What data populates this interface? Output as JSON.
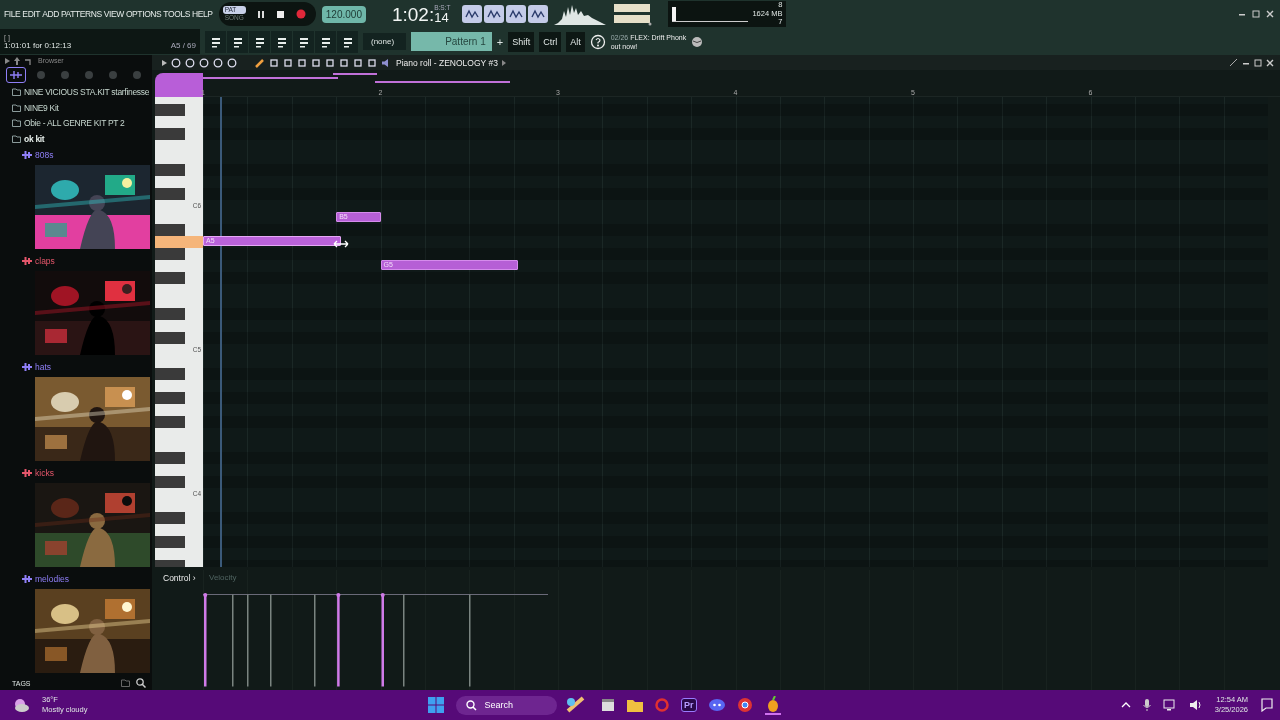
{
  "menu": [
    "FILE",
    "EDIT",
    "ADD",
    "PATTERNS",
    "VIEW",
    "OPTIONS",
    "TOOLS",
    "HELP"
  ],
  "transport": {
    "modes": [
      {
        "label": "PAT",
        "selected": true
      },
      {
        "label": "SONG",
        "selected": false
      }
    ],
    "tempo": "120.000",
    "time": "1:02:",
    "time_ticks": "14",
    "time_format": "B:S:T"
  },
  "hint": {
    "brackets": "[ ]",
    "position": "1:01:01 for 0:12:13",
    "note": "A5 / 69"
  },
  "channel": "(none)",
  "pattern": {
    "name": "Pattern 1",
    "add": "+"
  },
  "modifier_keys": [
    "Shift",
    "Ctrl",
    "Alt"
  ],
  "monitor": {
    "level": 0.04,
    "cpu": "8",
    "memory": "1624 MB",
    "polyphony": "7"
  },
  "news": {
    "date": "02/26",
    "text": "FLEX: Drift Phonk",
    "text_2": "out now!"
  },
  "browser": {
    "title": "Browser",
    "tabs": [
      {
        "selected": true
      },
      {
        "selected": false
      },
      {
        "selected": false
      },
      {
        "selected": false
      },
      {
        "selected": false
      },
      {
        "selected": false
      }
    ],
    "tree": [
      {
        "label": "NINE VICIOUS STA.KIT starfinesse"
      },
      {
        "label": "NINE9 Kit"
      },
      {
        "label": "Obie - ALL GENRE KIT PT 2"
      },
      {
        "label": "ok kit",
        "children": [
          {
            "label": "808s",
            "color": "#8f7ff7"
          },
          {
            "label": "claps",
            "color": "#e5566b"
          },
          {
            "label": "hats",
            "color": "#8f7ff7"
          },
          {
            "label": "kicks",
            "color": "#e5566b"
          },
          {
            "label": "melodies",
            "color": "#8f7ff7"
          }
        ]
      }
    ],
    "footer": "TAGS"
  },
  "piano_roll": {
    "title": "Piano roll - ZENOLOGY #3",
    "bars": [
      "1",
      "2",
      "3",
      "4",
      "5",
      "6"
    ],
    "key_labels": [
      "C6",
      "C5",
      "C4"
    ],
    "notes": [
      {
        "label": "B5",
        "selected": false
      },
      {
        "label": "A5",
        "selected": true
      },
      {
        "label": "G5",
        "selected": false
      }
    ],
    "control": {
      "label": "Control",
      "separator": "›",
      "parameter": "Velocity"
    }
  },
  "taskbar": {
    "temperature": "36°F",
    "condition": "Mostly cloudy",
    "search": "Search",
    "app_badge": "Pr",
    "time": "12:54 AM",
    "date": "3/25/2026"
  }
}
